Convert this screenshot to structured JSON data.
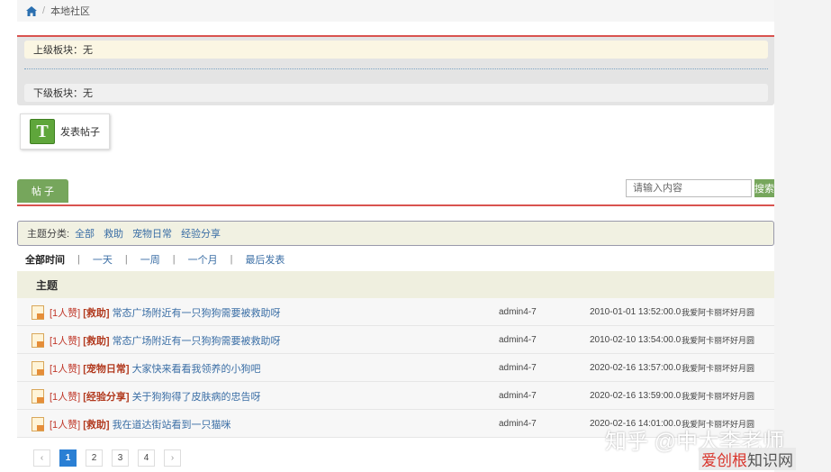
{
  "breadcrumb": {
    "separator": "/",
    "current": "本地社区"
  },
  "board": {
    "parent_label": "上级板块：",
    "parent_value": "无",
    "child_label": "下级板块：",
    "child_value": "无"
  },
  "post_button": {
    "icon_letter": "T",
    "label": "发表帖子"
  },
  "tabs": {
    "posts_label": "帖 子"
  },
  "search": {
    "placeholder": "请输入内容",
    "button_label": "搜索"
  },
  "category": {
    "label": "主题分类:",
    "items": [
      "全部",
      "救助",
      "宠物日常",
      "经验分享"
    ]
  },
  "time_filter": {
    "items": [
      "全部时间",
      "一天",
      "一周",
      "一个月",
      "最后发表"
    ],
    "separator": "|"
  },
  "table": {
    "header": "主题",
    "rows": [
      {
        "likes": "[1人赞]",
        "category": "[救助]",
        "title": "常态广场附近有一只狗狗需要被救助呀",
        "author": "admin4-7",
        "date": "2010-01-01 13:52:00.0",
        "last": "我爱阿卡丽坏好月圆"
      },
      {
        "likes": "[1人赞]",
        "category": "[救助]",
        "title": "常态广场附近有一只狗狗需要被救助呀",
        "author": "admin4-7",
        "date": "2010-02-10 13:54:00.0",
        "last": "我爱阿卡丽坏好月圆"
      },
      {
        "likes": "[1人赞]",
        "category": "[宠物日常]",
        "title": "大家快来看看我领养的小狗吧",
        "author": "admin4-7",
        "date": "2020-02-16 13:57:00.0",
        "last": "我爱阿卡丽坏好月圆"
      },
      {
        "likes": "[1人赞]",
        "category": "[经验分享]",
        "title": "关于狗狗得了皮肤病的忠告呀",
        "author": "admin4-7",
        "date": "2020-02-16 13:59:00.0",
        "last": "我爱阿卡丽坏好月圆"
      },
      {
        "likes": "[1人赞]",
        "category": "[救助]",
        "title": "我在道达街站看到一只猫咪",
        "author": "admin4-7",
        "date": "2020-02-16 14:01:00.0",
        "last": "我爱阿卡丽坏好月圆"
      }
    ]
  },
  "pagination": {
    "prev": "‹",
    "pages": [
      "1",
      "2",
      "3",
      "4"
    ],
    "next": "›",
    "current": "1"
  },
  "watermark": {
    "line1": "知乎 @中大李老师",
    "line2_red": "爱创根",
    "line2_dark": "知识网"
  },
  "colors": {
    "accent_red": "#d9534f",
    "green": "#76a65c",
    "link_blue": "#3a6ea5",
    "page_active": "#2a7fd4"
  }
}
